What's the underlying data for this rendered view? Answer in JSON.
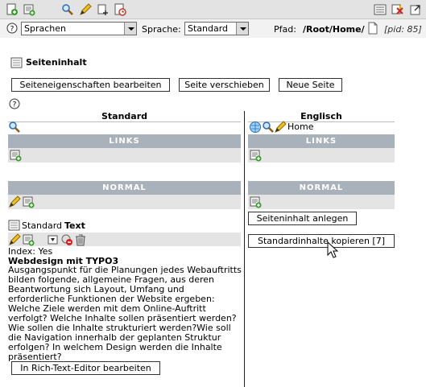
{
  "toolbar": {
    "icons": [
      "new-page-icon",
      "new-element-icon",
      "search-icon",
      "edit-pencil-icon",
      "move-page-icon",
      "history-icon",
      "list-view-icon",
      "clear-cache-icon",
      "open-new-window-icon"
    ]
  },
  "subbar": {
    "view_select": "Sprachen",
    "language_label": "Sprache:",
    "language_select": "Standard",
    "path_label": "Pfad:",
    "path_value": "/Root/Home/",
    "pid": "[pid: 85]"
  },
  "module_title": "Seiteninhalt",
  "buttons": {
    "edit_page_props": "Seiteneigenschaften bearbeiten",
    "move_page": "Seite verschieben",
    "new_page": "Neue Seite",
    "create_content": "Seiteninhalt anlegen",
    "copy_default": "Standardinhalte kopieren [7]",
    "rte_edit": "In Rich-Text-Editor bearbeiten"
  },
  "columns": {
    "left_header": "Standard",
    "right_header": "Englisch",
    "right_page_title": "Home"
  },
  "sections": {
    "links": "LINKS",
    "normal": "NORMAL"
  },
  "content_element": {
    "lang_label": "Standard",
    "type_label": "Text",
    "index_label": "Index: Yes",
    "heading": "Webdesign mit TYPO3",
    "body": "Ausgangspunkt für die Planungen jedes Webauftritts bilden folgende, allgemeine Fragen, aus deren Beantwortung sich Layout, Umfang und erforderliche Funktionen der Website ergeben: Welche Ziele werden mit dem Online-Auftritt verfolgt? Welche Inhalte sollen präsentiert werden? Wie sollen die Inhalte strukturiert werden?Wie soll die Navigation innerhalb der geplanten Struktur erfolgen? In welchem Design werden die Inhalte präsentiert?"
  },
  "colors": {
    "bar": "#a9b1ba",
    "panel": "#e4e4e4",
    "toolbar": "#e3e3e3"
  }
}
